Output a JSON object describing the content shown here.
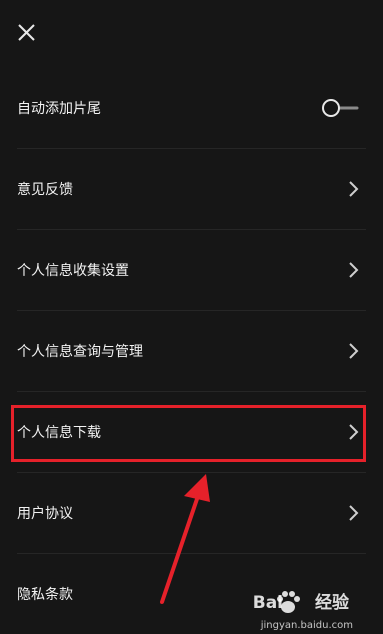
{
  "header": {
    "close_icon": "close-icon"
  },
  "settings": [
    {
      "label": "自动添加片尾",
      "control": "toggle",
      "toggle_on": false
    },
    {
      "label": "意见反馈",
      "control": "chevron"
    },
    {
      "label": "个人信息收集设置",
      "control": "chevron"
    },
    {
      "label": "个人信息查询与管理",
      "control": "chevron"
    },
    {
      "label": "个人信息下载",
      "control": "chevron",
      "highlighted": true
    },
    {
      "label": "用户协议",
      "control": "chevron"
    },
    {
      "label": "隐私条款",
      "control": "none"
    }
  ],
  "annotation": {
    "highlight_color": "#e6212a",
    "arrow_color": "#e6212a"
  },
  "watermark": {
    "brand": "Bai",
    "brand_suffix": "经验",
    "url": "jingyan.baidu.com"
  }
}
